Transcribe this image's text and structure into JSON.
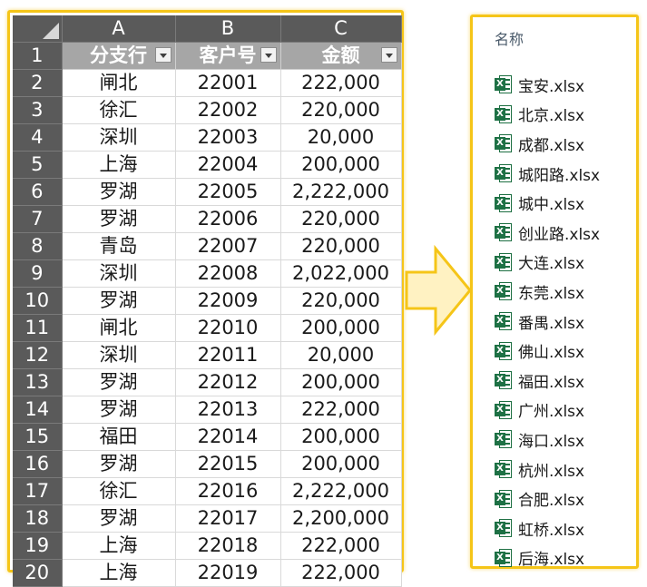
{
  "spreadsheet": {
    "column_headers": [
      "A",
      "B",
      "C"
    ],
    "table_headers": [
      "分支行",
      "客户号",
      "金额"
    ],
    "rows": [
      {
        "row": "2",
        "branch": "闸北",
        "customer_id": "22001",
        "amount": "222,000"
      },
      {
        "row": "3",
        "branch": "徐汇",
        "customer_id": "22002",
        "amount": "220,000"
      },
      {
        "row": "4",
        "branch": "深圳",
        "customer_id": "22003",
        "amount": "20,000"
      },
      {
        "row": "5",
        "branch": "上海",
        "customer_id": "22004",
        "amount": "200,000"
      },
      {
        "row": "6",
        "branch": "罗湖",
        "customer_id": "22005",
        "amount": "2,222,000"
      },
      {
        "row": "7",
        "branch": "罗湖",
        "customer_id": "22006",
        "amount": "220,000"
      },
      {
        "row": "8",
        "branch": "青岛",
        "customer_id": "22007",
        "amount": "220,000"
      },
      {
        "row": "9",
        "branch": "深圳",
        "customer_id": "22008",
        "amount": "2,022,000"
      },
      {
        "row": "10",
        "branch": "罗湖",
        "customer_id": "22009",
        "amount": "220,000"
      },
      {
        "row": "11",
        "branch": "闸北",
        "customer_id": "22010",
        "amount": "200,000"
      },
      {
        "row": "12",
        "branch": "深圳",
        "customer_id": "22011",
        "amount": "20,000"
      },
      {
        "row": "13",
        "branch": "罗湖",
        "customer_id": "22012",
        "amount": "200,000"
      },
      {
        "row": "14",
        "branch": "罗湖",
        "customer_id": "22013",
        "amount": "222,000"
      },
      {
        "row": "15",
        "branch": "福田",
        "customer_id": "22014",
        "amount": "200,000"
      },
      {
        "row": "16",
        "branch": "罗湖",
        "customer_id": "22015",
        "amount": "200,000"
      },
      {
        "row": "17",
        "branch": "徐汇",
        "customer_id": "22016",
        "amount": "2,222,000"
      },
      {
        "row": "18",
        "branch": "罗湖",
        "customer_id": "22017",
        "amount": "2,200,000"
      },
      {
        "row": "19",
        "branch": "上海",
        "customer_id": "22018",
        "amount": "222,000"
      },
      {
        "row": "20",
        "branch": "上海",
        "customer_id": "22019",
        "amount": "222,000"
      }
    ],
    "header_row_number": "1"
  },
  "arrow": {
    "fill": "#fff2c2",
    "stroke": "#f5c518"
  },
  "file_panel": {
    "header": "名称",
    "icon": "excel-file-icon",
    "icon_letter": "X",
    "files": [
      "宝安.xlsx",
      "北京.xlsx",
      "成都.xlsx",
      "城阳路.xlsx",
      "城中.xlsx",
      "创业路.xlsx",
      "大连.xlsx",
      "东莞.xlsx",
      "番禺.xlsx",
      "佛山.xlsx",
      "福田.xlsx",
      "广州.xlsx",
      "海口.xlsx",
      "杭州.xlsx",
      "合肥.xlsx",
      "虹桥.xlsx",
      "后海.xlsx"
    ]
  },
  "colors": {
    "highlight_border": "#f5c518",
    "excel_green": "#1e7145",
    "header_gray": "#5a5a5a",
    "table_header_gray": "#a6a6a6"
  }
}
